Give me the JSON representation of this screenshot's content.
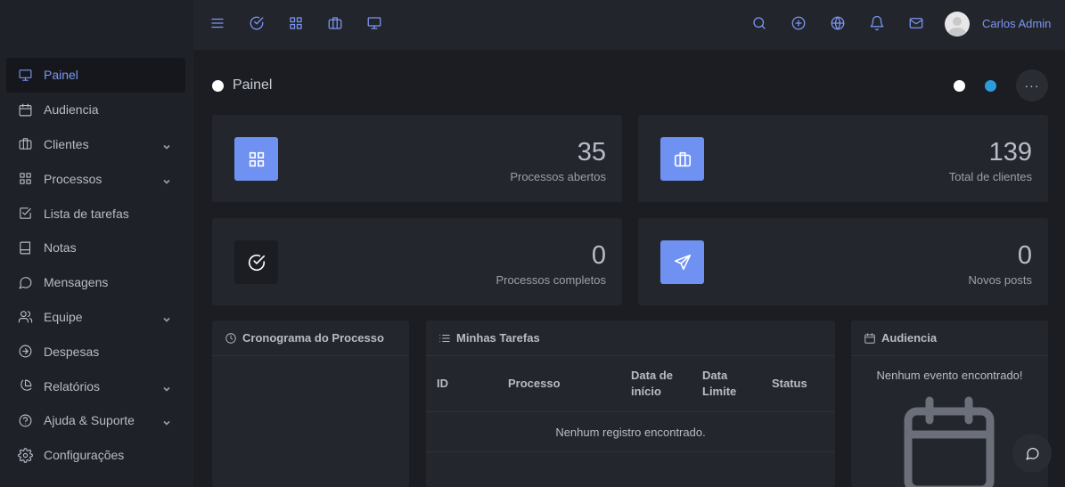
{
  "topbar": {
    "icons": [
      "menu-icon",
      "check-circle-icon",
      "grid-icon",
      "briefcase-icon",
      "monitor-icon",
      "search-icon",
      "plus-circle-icon",
      "globe-icon",
      "bell-icon",
      "mail-icon"
    ],
    "user_name": "Carlos Admin"
  },
  "sidebar": {
    "items": [
      {
        "label": "Painel",
        "icon": "monitor-icon",
        "active": true,
        "has_submenu": false
      },
      {
        "label": "Audiencia",
        "icon": "calendar-icon",
        "active": false,
        "has_submenu": false
      },
      {
        "label": "Clientes",
        "icon": "briefcase-icon",
        "active": false,
        "has_submenu": true
      },
      {
        "label": "Processos",
        "icon": "grid-icon",
        "active": false,
        "has_submenu": true
      },
      {
        "label": "Lista de tarefas",
        "icon": "check-square-icon",
        "active": false,
        "has_submenu": false
      },
      {
        "label": "Notas",
        "icon": "book-icon",
        "active": false,
        "has_submenu": false
      },
      {
        "label": "Mensagens",
        "icon": "message-circle-icon",
        "active": false,
        "has_submenu": false
      },
      {
        "label": "Equipe",
        "icon": "users-icon",
        "active": false,
        "has_submenu": true
      },
      {
        "label": "Despesas",
        "icon": "arrow-right-circle-icon",
        "active": false,
        "has_submenu": false
      },
      {
        "label": "Relatórios",
        "icon": "pie-chart-icon",
        "active": false,
        "has_submenu": true
      },
      {
        "label": "Ajuda & Suporte",
        "icon": "help-circle-icon",
        "active": false,
        "has_submenu": true
      },
      {
        "label": "Configurações",
        "icon": "settings-icon",
        "active": false,
        "has_submenu": false
      }
    ]
  },
  "page": {
    "title": "Painel",
    "theme_colors": [
      "#ffffff",
      "#2d9cdb"
    ],
    "more_label": "···"
  },
  "stats": [
    {
      "value": "35",
      "caption": "Processos abertos",
      "icon": "grid-icon",
      "color": "#6f91f2"
    },
    {
      "value": "139",
      "caption": "Total de clientes",
      "icon": "briefcase-icon",
      "color": "#6f91f2"
    },
    {
      "value": "0",
      "caption": "Processos completos",
      "icon": "check-circle-icon",
      "color": "#1c1d23"
    },
    {
      "value": "0",
      "caption": "Novos posts",
      "icon": "send-icon",
      "color": "#6f91f2"
    }
  ],
  "panels": {
    "timeline": {
      "title": "Cronograma do Processo"
    },
    "tasks": {
      "title": "Minhas Tarefas",
      "columns": [
        "ID",
        "Processo",
        "Data de início",
        "Data Limite",
        "Status"
      ],
      "empty_text": "Nenhum registro encontrado."
    },
    "audiencia": {
      "title": "Audiencia",
      "empty_text": "Nenhum evento encontrado!"
    }
  }
}
